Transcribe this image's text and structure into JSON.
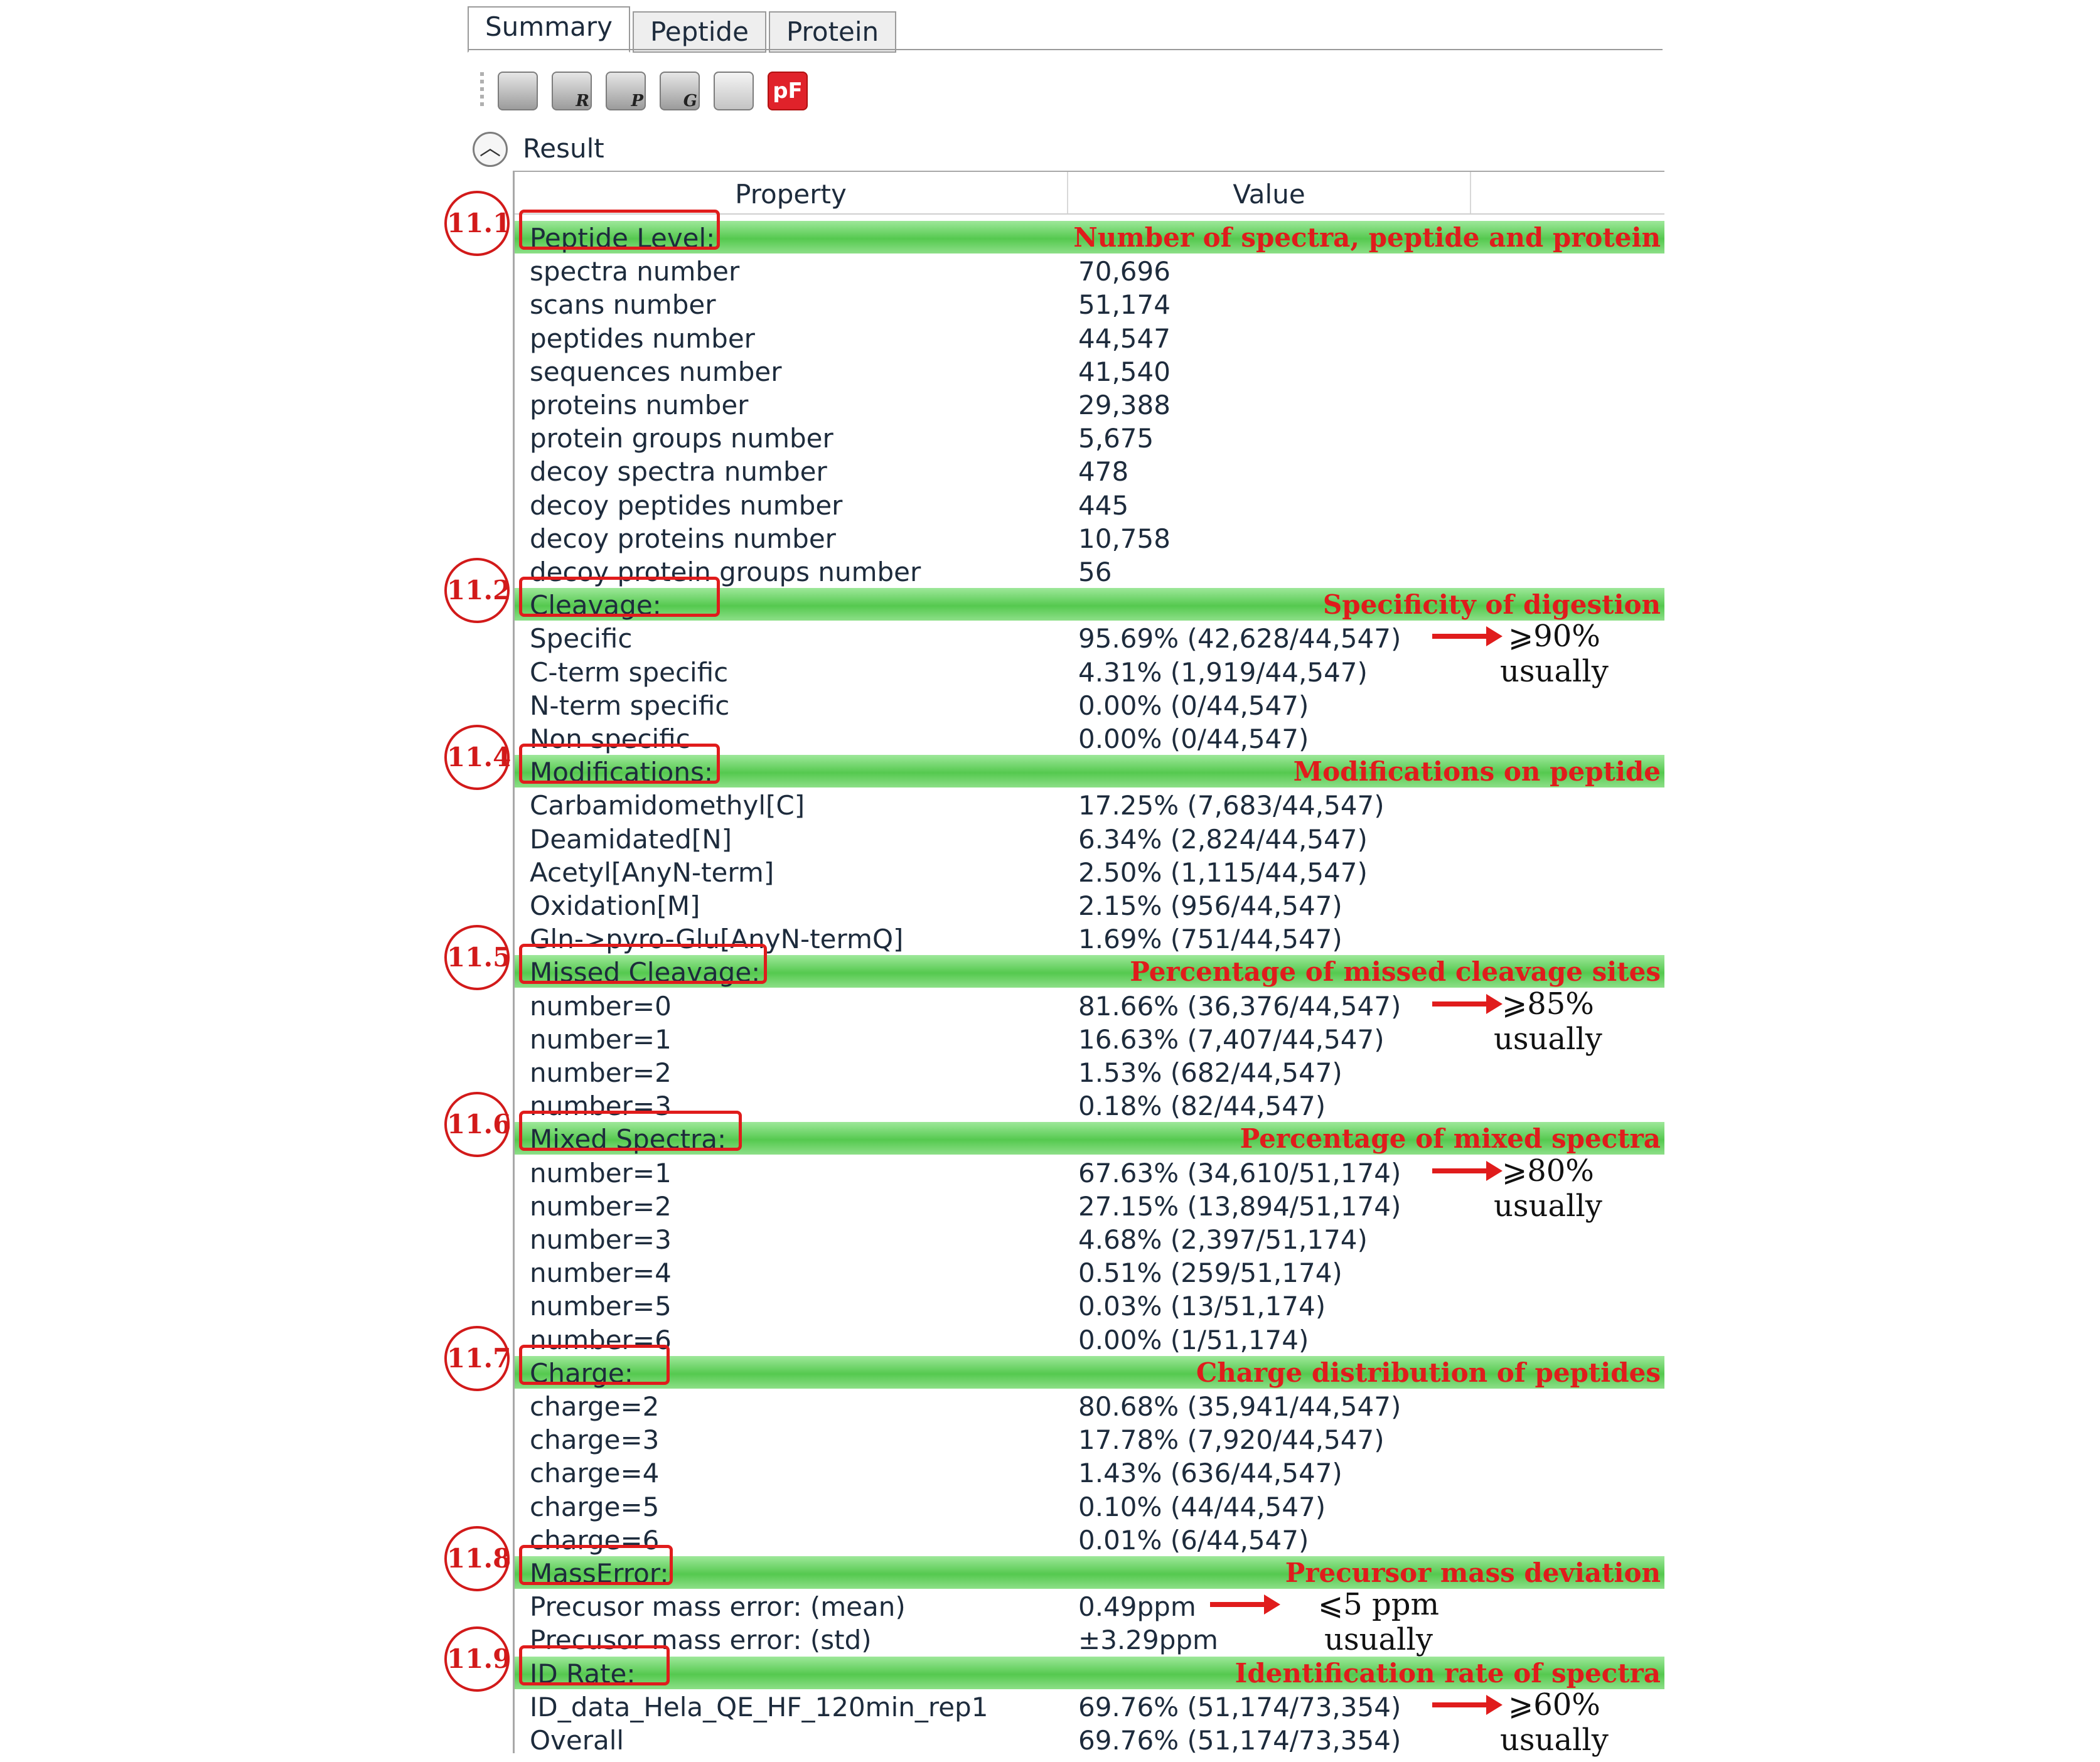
{
  "tabs": [
    {
      "label": "Summary",
      "active": true
    },
    {
      "label": "Peptide",
      "active": false
    },
    {
      "label": "Protein",
      "active": false
    }
  ],
  "toolbar": {
    "icons": [
      "printer-icon",
      "print-report-icon",
      "print-peptide-icon",
      "print-group-icon",
      "email-icon",
      "pfind-logo-icon"
    ],
    "badges": [
      "",
      "R",
      "P",
      "G",
      "",
      ""
    ],
    "pf_label": "pF"
  },
  "result": {
    "label": "Result"
  },
  "table": {
    "headers": {
      "property": "Property",
      "value": "Value"
    },
    "sections": [
      {
        "id": "11.1",
        "title": "Peptide Level:",
        "note": "Number of spectra, peptide and protein",
        "rows": [
          [
            "spectra number",
            "70,696"
          ],
          [
            "scans number",
            "51,174"
          ],
          [
            "peptides number",
            "44,547"
          ],
          [
            "sequences number",
            "41,540"
          ],
          [
            "proteins number",
            "29,388"
          ],
          [
            "protein groups number",
            "5,675"
          ],
          [
            "decoy spectra number",
            "478"
          ],
          [
            "decoy peptides number",
            "445"
          ],
          [
            "decoy proteins number",
            "10,758"
          ],
          [
            "decoy protein groups number",
            "56"
          ]
        ]
      },
      {
        "id": "11.2",
        "title": "Cleavage:",
        "note": "Specificity of digestion",
        "rows": [
          [
            "Specific",
            "95.69% (42,628/44,547)"
          ],
          [
            "C-term specific",
            "4.31% (1,919/44,547)"
          ],
          [
            "N-term specific",
            "0.00% (0/44,547)"
          ],
          [
            "Non specific",
            "0.00% (0/44,547)"
          ]
        ]
      },
      {
        "id": "11.4",
        "title": "Modifications:",
        "note": "Modifications on peptide",
        "rows": [
          [
            "Carbamidomethyl[C]",
            "17.25% (7,683/44,547)"
          ],
          [
            "Deamidated[N]",
            "6.34% (2,824/44,547)"
          ],
          [
            "Acetyl[AnyN-term]",
            "2.50% (1,115/44,547)"
          ],
          [
            "Oxidation[M]",
            "2.15% (956/44,547)"
          ],
          [
            "Gln->pyro-Glu[AnyN-termQ]",
            "1.69% (751/44,547)"
          ]
        ]
      },
      {
        "id": "11.5",
        "title": "Missed Cleavage:",
        "note": "Percentage of missed cleavage sites",
        "rows": [
          [
            "number=0",
            "81.66% (36,376/44,547)"
          ],
          [
            "number=1",
            "16.63% (7,407/44,547)"
          ],
          [
            "number=2",
            "1.53% (682/44,547)"
          ],
          [
            "number=3",
            "0.18% (82/44,547)"
          ]
        ]
      },
      {
        "id": "11.6",
        "title": "Mixed Spectra:",
        "note": "Percentage of mixed spectra",
        "rows": [
          [
            "number=1",
            "67.63% (34,610/51,174)"
          ],
          [
            "number=2",
            "27.15% (13,894/51,174)"
          ],
          [
            "number=3",
            "4.68% (2,397/51,174)"
          ],
          [
            "number=4",
            "0.51% (259/51,174)"
          ],
          [
            "number=5",
            "0.03% (13/51,174)"
          ],
          [
            "number=6",
            "0.00% (1/51,174)"
          ]
        ]
      },
      {
        "id": "11.7",
        "title": "Charge:",
        "note": "Charge distribution of peptides",
        "rows": [
          [
            "charge=2",
            "80.68% (35,941/44,547)"
          ],
          [
            "charge=3",
            "17.78% (7,920/44,547)"
          ],
          [
            "charge=4",
            "1.43% (636/44,547)"
          ],
          [
            "charge=5",
            "0.10% (44/44,547)"
          ],
          [
            "charge=6",
            "0.01% (6/44,547)"
          ]
        ]
      },
      {
        "id": "11.8",
        "title": "MassError:",
        "note": "Precursor mass deviation",
        "rows": [
          [
            "Precusor mass error: (mean)",
            "0.49ppm"
          ],
          [
            "Precusor mass error: (std)",
            "±3.29ppm"
          ]
        ]
      },
      {
        "id": "11.9",
        "title": "ID Rate:",
        "note": "Identification rate of spectra",
        "rows": [
          [
            "ID_data_Hela_QE_HF_120min_rep1",
            "69.76% (51,174/73,354)"
          ],
          [
            "Overall",
            "69.76% (51,174/73,354)"
          ]
        ]
      }
    ]
  },
  "hints": [
    {
      "value": "⩾90%",
      "sub": "usually"
    },
    {
      "value": "⩾85%",
      "sub": "usually"
    },
    {
      "value": "⩾80%",
      "sub": "usually"
    },
    {
      "value": "⩽5 ppm",
      "sub": "usually"
    },
    {
      "value": "⩾60%",
      "sub": "usually"
    }
  ]
}
